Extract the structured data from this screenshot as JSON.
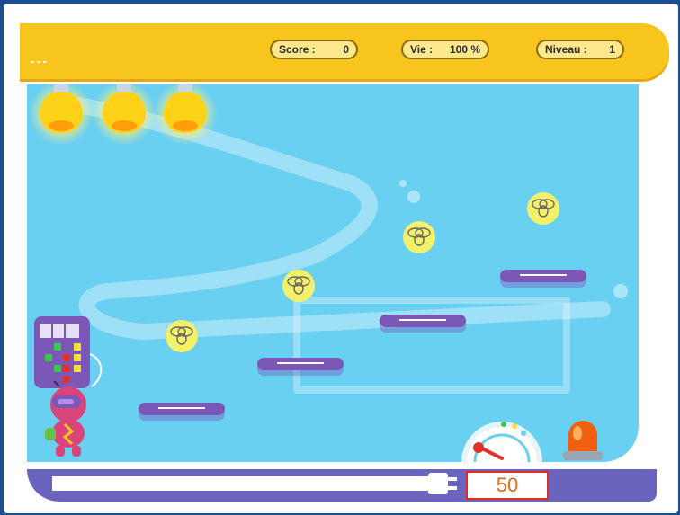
{
  "header": {
    "name_placeholder": "---",
    "score_label": "Score :",
    "score_value": "0",
    "life_label": "Vie :",
    "life_value": "100 %",
    "level_label": "Niveau :",
    "level_value": "1"
  },
  "footer": {
    "timer_value": "50"
  },
  "colors": {
    "header_bar": "#f8c51e",
    "sky": "#6ad0f2",
    "platform": "#7b58b8",
    "timer_border": "#e02a20"
  },
  "icons": {
    "lamps": [
      "ceiling-lamp-icon",
      "ceiling-lamp-icon",
      "ceiling-lamp-icon"
    ],
    "flies": [
      "fly-icon",
      "fly-icon",
      "fly-icon",
      "fly-icon"
    ],
    "player": "robot-player-icon",
    "alarm": "alarm-light-icon",
    "gauge": "gauge-icon",
    "plug": "power-plug-icon"
  }
}
